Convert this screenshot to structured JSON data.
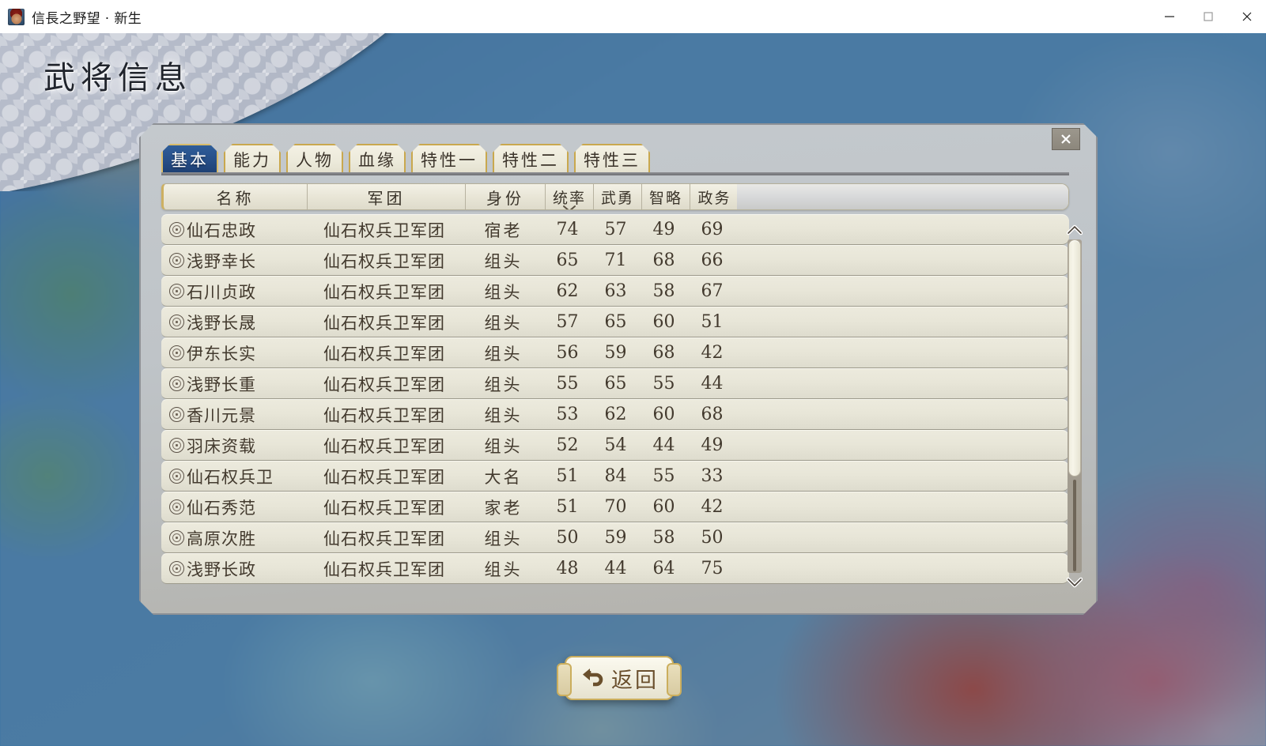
{
  "window": {
    "title": "信長之野望 · 新生",
    "app_icon": "warlord-portrait-icon",
    "controls": {
      "minimize": "minimize-icon",
      "maximize": "maximize-icon",
      "close": "close-icon"
    }
  },
  "page": {
    "title": "武将信息"
  },
  "dialog": {
    "close_label": "✕",
    "tabs": [
      {
        "label": "基本",
        "active": true,
        "width": "w2"
      },
      {
        "label": "能力",
        "active": false,
        "width": "w2"
      },
      {
        "label": "人物",
        "active": false,
        "width": "w2"
      },
      {
        "label": "血缘",
        "active": false,
        "width": "w2"
      },
      {
        "label": "特性一",
        "active": false,
        "width": "w3"
      },
      {
        "label": "特性二",
        "active": false,
        "width": "w3"
      },
      {
        "label": "特性三",
        "active": false,
        "width": "w3"
      }
    ],
    "table": {
      "columns": [
        {
          "key": "name",
          "label": "名称",
          "class": "name",
          "sorted": false
        },
        {
          "key": "corps",
          "label": "军团",
          "class": "corps",
          "sorted": false
        },
        {
          "key": "rank",
          "label": "身份",
          "class": "rank",
          "sorted": false
        },
        {
          "key": "tong",
          "label": "统率",
          "class": "stat",
          "sorted": true
        },
        {
          "key": "wu",
          "label": "武勇",
          "class": "stat",
          "sorted": false
        },
        {
          "key": "zhi",
          "label": "智略",
          "class": "stat",
          "sorted": false
        },
        {
          "key": "zheng",
          "label": "政务",
          "class": "stat last",
          "sorted": false
        }
      ],
      "sort_column": "统率",
      "sort_direction": "descending",
      "rows": [
        {
          "name": "仙石忠政",
          "corps": "仙石权兵卫军团",
          "rank": "宿老",
          "tong": "74",
          "wu": "57",
          "zhi": "49",
          "zheng": "69"
        },
        {
          "name": "浅野幸长",
          "corps": "仙石权兵卫军团",
          "rank": "组头",
          "tong": "65",
          "wu": "71",
          "zhi": "68",
          "zheng": "66"
        },
        {
          "name": "石川贞政",
          "corps": "仙石权兵卫军团",
          "rank": "组头",
          "tong": "62",
          "wu": "63",
          "zhi": "58",
          "zheng": "67"
        },
        {
          "name": "浅野长晟",
          "corps": "仙石权兵卫军团",
          "rank": "组头",
          "tong": "57",
          "wu": "65",
          "zhi": "60",
          "zheng": "51"
        },
        {
          "name": "伊东长实",
          "corps": "仙石权兵卫军团",
          "rank": "组头",
          "tong": "56",
          "wu": "59",
          "zhi": "68",
          "zheng": "42"
        },
        {
          "name": "浅野长重",
          "corps": "仙石权兵卫军团",
          "rank": "组头",
          "tong": "55",
          "wu": "65",
          "zhi": "55",
          "zheng": "44"
        },
        {
          "name": "香川元景",
          "corps": "仙石权兵卫军团",
          "rank": "组头",
          "tong": "53",
          "wu": "62",
          "zhi": "60",
          "zheng": "68"
        },
        {
          "name": "羽床资载",
          "corps": "仙石权兵卫军团",
          "rank": "组头",
          "tong": "52",
          "wu": "54",
          "zhi": "44",
          "zheng": "49"
        },
        {
          "name": "仙石权兵卫",
          "corps": "仙石权兵卫军团",
          "rank": "大名",
          "tong": "51",
          "wu": "84",
          "zhi": "55",
          "zheng": "33"
        },
        {
          "name": "仙石秀范",
          "corps": "仙石权兵卫军团",
          "rank": "家老",
          "tong": "51",
          "wu": "70",
          "zhi": "60",
          "zheng": "42"
        },
        {
          "name": "高原次胜",
          "corps": "仙石权兵卫军团",
          "rank": "组头",
          "tong": "50",
          "wu": "59",
          "zhi": "58",
          "zheng": "50"
        },
        {
          "name": "浅野长政",
          "corps": "仙石权兵卫军团",
          "rank": "组头",
          "tong": "48",
          "wu": "44",
          "zhi": "64",
          "zheng": "75"
        }
      ]
    },
    "scrollbar": {
      "up_icon": "chevron-up-icon",
      "down_icon": "chevron-down-icon",
      "thumb_percent": 71
    }
  },
  "footer": {
    "back_label": "返回",
    "back_icon": "back-arrow-icon"
  },
  "colors": {
    "accent_blue": "#27508a",
    "gold_border": "#c9a84e",
    "panel_grey": "#bfc4c8",
    "row_cream": "#e8e6d8",
    "text_brown": "#433a2e",
    "back_text": "#6a4f2c"
  }
}
